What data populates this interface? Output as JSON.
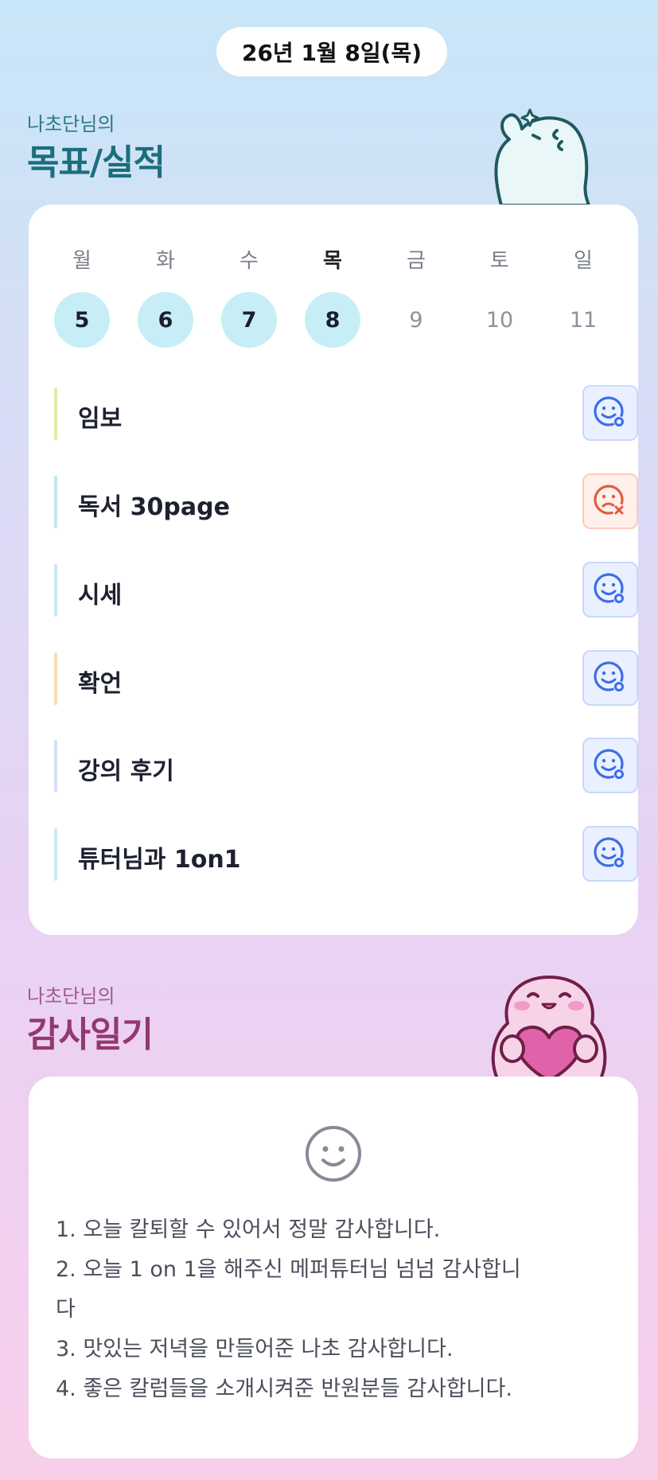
{
  "header": {
    "date": "26년 1월 8일(목)"
  },
  "goals_section": {
    "subtitle": "나초단님의",
    "title": "목표/실적"
  },
  "week": {
    "days": [
      {
        "name": "월",
        "num": "5",
        "state": "done"
      },
      {
        "name": "화",
        "num": "6",
        "state": "done"
      },
      {
        "name": "수",
        "num": "7",
        "state": "done"
      },
      {
        "name": "목",
        "num": "8",
        "state": "today"
      },
      {
        "name": "금",
        "num": "9",
        "state": "future"
      },
      {
        "name": "토",
        "num": "10",
        "state": "future"
      },
      {
        "name": "일",
        "num": "11",
        "state": "future"
      }
    ]
  },
  "goals": [
    {
      "label": "임보",
      "status": "achieved",
      "bar_color": "#dbeea8"
    },
    {
      "label": "독서 30page",
      "status": "failed",
      "bar_color": "#bfe9e6"
    },
    {
      "label": "시세",
      "status": "achieved",
      "bar_color": "#c9e7f0"
    },
    {
      "label": "확언",
      "status": "achieved",
      "bar_color": "#fbd9b6"
    },
    {
      "label": "강의 후기",
      "status": "achieved",
      "bar_color": "#d4def4"
    },
    {
      "label": "튜터님과 1on1",
      "status": "achieved",
      "bar_color": "#c6ecf2"
    }
  ],
  "gratitude_section": {
    "subtitle": "나초단님의",
    "title": "감사일기"
  },
  "gratitude": {
    "icon": "smile-icon",
    "lines": [
      "1. 오늘 칼퇴할 수 있어서 정말 감사합니다.",
      "2. 오늘 1 on 1을 해주신 메퍼튜터님 넘넘 감사합니",
      "다",
      "3. 맛있는 저녁을 만들어준 나초 감사합니다.",
      "4. 좋은 칼럼들을 소개시켜준 반원분들 감사합니다."
    ]
  },
  "colors": {
    "done_day": "#c7eef6",
    "achieved_icon": "#3c6ee6",
    "failed_icon": "#e45b3f"
  }
}
